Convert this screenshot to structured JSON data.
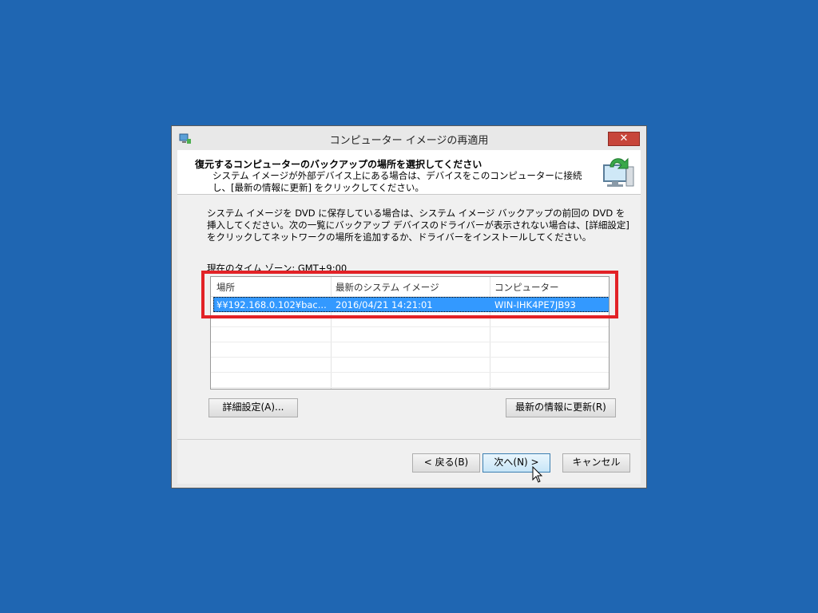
{
  "window": {
    "title": "コンピューター イメージの再適用",
    "close_glyph": "✕"
  },
  "header": {
    "title": "復元するコンピューターのバックアップの場所を選択してください",
    "description": "システム イメージが外部デバイス上にある場合は、デバイスをこのコンピューターに接続し、[最新の情報に更新] をクリックしてください。"
  },
  "content": {
    "intro": "システム イメージを DVD に保存している場合は、システム イメージ バックアップの前回の DVD を挿入してください。次の一覧にバックアップ デバイスのドライバーが表示されない場合は、[詳細設定] をクリックしてネットワークの場所を追加するか、ドライバーをインストールしてください。",
    "timezone": "現在のタイム ゾーン: GMT+9:00"
  },
  "table": {
    "columns": [
      "場所",
      "最新のシステム イメージ",
      "コンピューター"
    ],
    "rows": [
      [
        "¥¥192.168.0.102¥bac...",
        "2016/04/21 14:21:01",
        "WIN-IHK4PE7JB93"
      ]
    ]
  },
  "buttons": {
    "advanced": "詳細設定(A)...",
    "refresh": "最新の情報に更新(R)",
    "back": "< 戻る(B)",
    "next": "次へ(N) >",
    "cancel": "キャンセル"
  },
  "colors": {
    "desktop": "#1f66b2",
    "selection": "#3399ff",
    "highlight_box": "#e22227",
    "close_button": "#c7453a"
  },
  "icons": [
    "app-icon",
    "close-icon",
    "backup-computer-icon",
    "mouse-cursor-icon"
  ]
}
